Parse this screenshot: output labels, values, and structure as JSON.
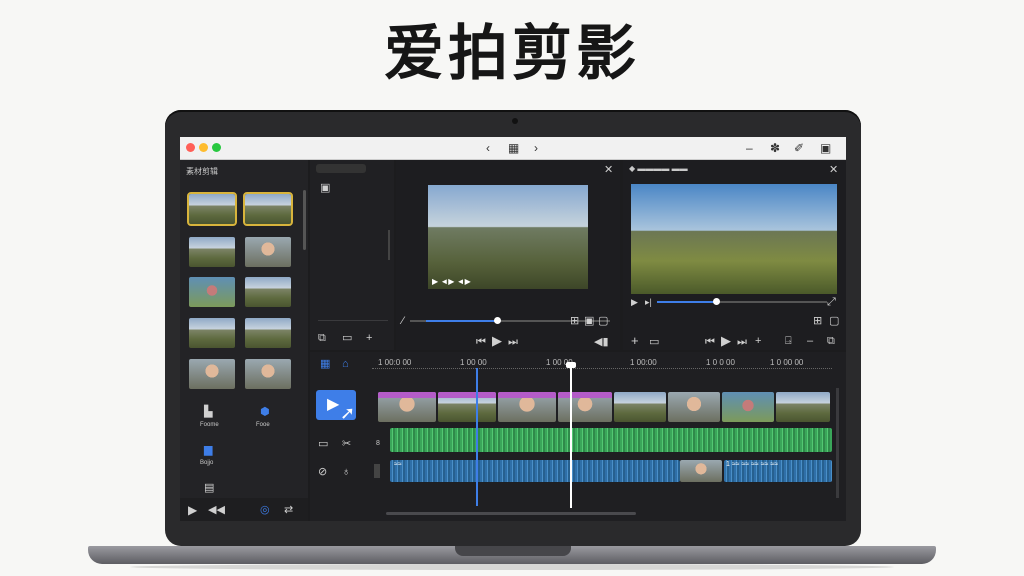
{
  "page_title": "爱拍剪影",
  "titlebar": {
    "back_icon": "‹",
    "forward_icon": "›",
    "center_icon": "▦"
  },
  "media_panel": {
    "header": "素材剪辑",
    "tools": [
      {
        "label": "Foome"
      },
      {
        "label": "Fooe"
      },
      {
        "label": "Bojjo"
      }
    ]
  },
  "source_viewer": {
    "timecode": "▶ ◄▶ ◄▶"
  },
  "program_viewer": {
    "header": "◆ ▬▬▬▬ ▬▬"
  },
  "timeline": {
    "ruler_marks": [
      "1 00:0 00",
      "1 00 00",
      "1 00 00",
      "1 00:00",
      "1 0 0 00",
      "1 0 00 00"
    ],
    "audio_clip_label": "≈≈",
    "audio_clip_label2": "1 ≈≈ ≈≈ ≈≈ ≈≈ ≈≈",
    "track_marker": "8"
  },
  "colors": {
    "accent": "#3e7ee8",
    "video_clip": "#b45cc8",
    "audio_green": "#3aa65a",
    "audio_blue": "#2f6fa8",
    "selection": "#d8b43c"
  },
  "icons": [
    "search-icon",
    "play-icon",
    "pause-icon",
    "cursor-icon",
    "waveform-icon",
    "scissors-icon"
  ]
}
